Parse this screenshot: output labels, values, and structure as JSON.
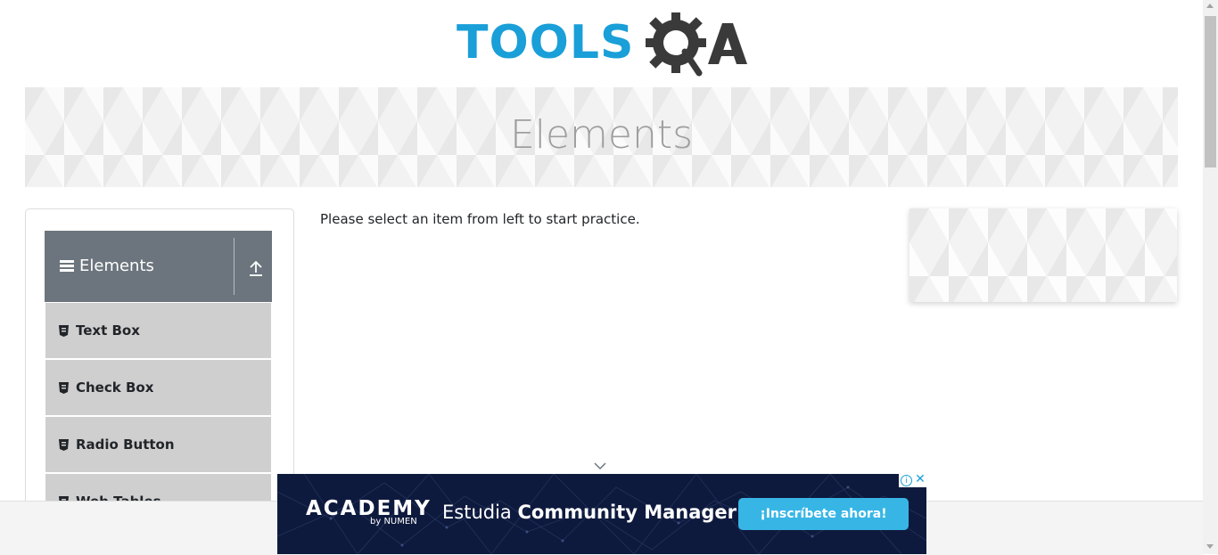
{
  "header": {
    "logo_text": "TOOLS",
    "logo_qa": "QA",
    "logo_icon": "gear-magnifier-icon",
    "brand_color": "#1a9fd8"
  },
  "banner": {
    "title": "Elements"
  },
  "sidebar": {
    "group_title": "Elements",
    "group_icons": [
      "menu-icon",
      "upload-icon"
    ],
    "items": [
      {
        "label": "Text Box"
      },
      {
        "label": "Check Box"
      },
      {
        "label": "Radio Button"
      },
      {
        "label": "Web Tables"
      }
    ]
  },
  "main": {
    "intro_text": "Please select an item from left to start practice."
  },
  "bottom_ad": {
    "brand": "ACADEMY",
    "byline": "by NUMEN",
    "headline_prefix": "Estudia ",
    "headline_strong": "Community Manager",
    "cta": "¡Inscríbete ahora!",
    "info_label": "i",
    "close_label": "✕",
    "background_color": "#0e1a3d",
    "cta_color": "#37b6e6"
  }
}
